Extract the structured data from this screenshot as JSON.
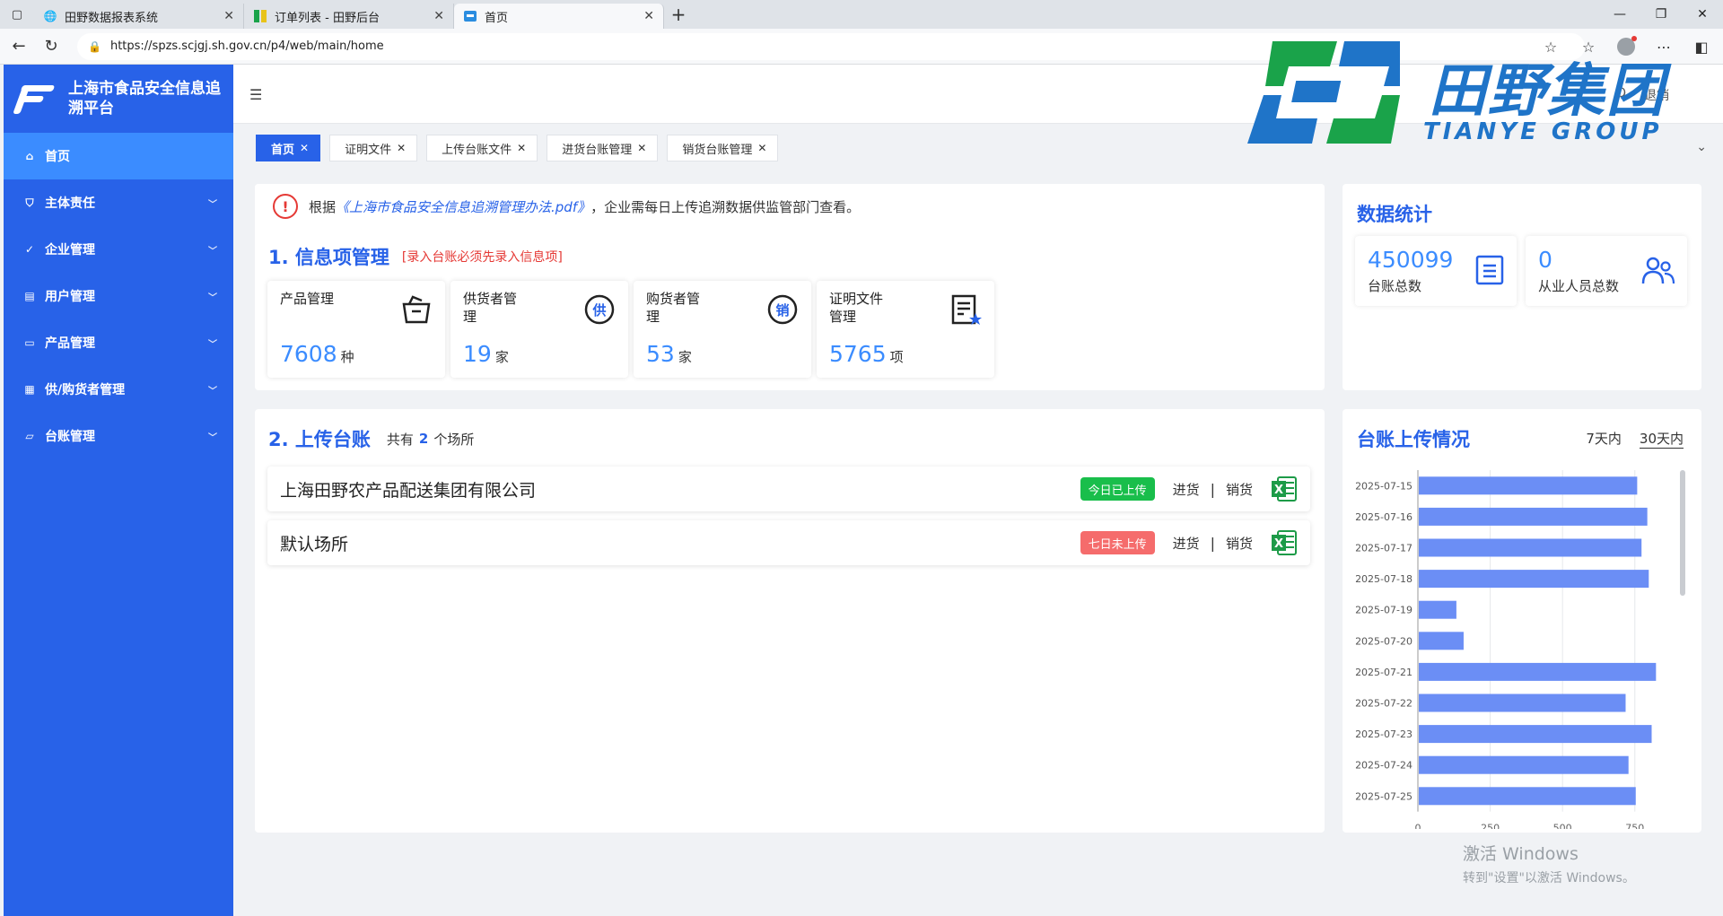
{
  "browser": {
    "tabs": [
      {
        "label": "田野数据报表系统",
        "icon": "globe-icon"
      },
      {
        "label": "订单列表 - 田野后台",
        "icon": "site-favicon"
      },
      {
        "label": "首页",
        "icon": "site-favicon"
      }
    ],
    "url": "https://spzs.scjgj.sh.gov.cn/p4/web/main/home"
  },
  "sidebar": {
    "title": "上海市食品安全信息追溯平台",
    "items": [
      {
        "label": "首页",
        "icon": "home-icon",
        "active": true
      },
      {
        "label": "主体责任",
        "icon": "shield-icon"
      },
      {
        "label": "企业管理",
        "icon": "shield-check-icon"
      },
      {
        "label": "用户管理",
        "icon": "id-card-icon"
      },
      {
        "label": "产品管理",
        "icon": "folder-icon"
      },
      {
        "label": "供/购货者管理",
        "icon": "contacts-icon"
      },
      {
        "label": "台账管理",
        "icon": "folder-open-icon"
      }
    ]
  },
  "header": {
    "user_partial": "Q",
    "user_partial2": "退销"
  },
  "tags": [
    {
      "label": "首页",
      "active": true
    },
    {
      "label": "证明文件"
    },
    {
      "label": "上传台账文件"
    },
    {
      "label": "进货台账管理"
    },
    {
      "label": "销货台账管理"
    }
  ],
  "notice": {
    "prefix": "根据",
    "link": "《上海市食品安全信息追溯管理办法.pdf》",
    "suffix": "，企业需每日上传追溯数据供监管部门查看。"
  },
  "info_section": {
    "title": "1. 信息项管理",
    "note": "[录入台账必须先录入信息项]",
    "tiles": [
      {
        "name": "产品管理",
        "value": "7608",
        "unit": "种",
        "icon": "basket-icon"
      },
      {
        "name": "供货者管理",
        "value": "19",
        "unit": "家",
        "icon": "supplier-icon",
        "glyph": "供"
      },
      {
        "name": "购货者管理",
        "value": "53",
        "unit": "家",
        "icon": "buyer-icon",
        "glyph": "销"
      },
      {
        "name": "证明文件管理",
        "value": "5765",
        "unit": "项",
        "icon": "certificate-icon"
      }
    ]
  },
  "upload_section": {
    "title": "2. 上传台账",
    "count_prefix": "共有",
    "count": "2",
    "count_suffix": "个场所",
    "places": [
      {
        "name": "上海田野农产品配送集团有限公司",
        "status": "今日已上传",
        "status_color": "#19be4b",
        "in": "进货",
        "sep": "|",
        "out": "销货"
      },
      {
        "name": "默认场所",
        "status": "七日未上传",
        "status_color": "#f56c6c",
        "in": "进货",
        "sep": "|",
        "out": "销货"
      }
    ]
  },
  "stats": {
    "title": "数据统计",
    "ledger_total": "450099",
    "ledger_label": "台账总数",
    "staff_total": "0",
    "staff_label": "从业人员总数"
  },
  "chart_card": {
    "title": "台账上传情况",
    "range_7": "7天内",
    "range_30": "30天内"
  },
  "chart_data": {
    "type": "bar",
    "orientation": "horizontal",
    "categories": [
      "2025-07-15",
      "2025-07-16",
      "2025-07-17",
      "2025-07-18",
      "2025-07-19",
      "2025-07-20",
      "2025-07-21",
      "2025-07-22",
      "2025-07-23",
      "2025-07-24",
      "2025-07-25"
    ],
    "values": [
      755,
      790,
      770,
      795,
      130,
      155,
      820,
      715,
      805,
      725,
      750
    ],
    "xlim": [
      0,
      850
    ],
    "xticks": [
      0,
      250,
      500,
      750
    ],
    "color": "#6b8ef5",
    "grid": true
  },
  "watermark": {
    "line1": "激活 Windows",
    "line2": "转到\"设置\"以激活 Windows。"
  },
  "overlay_logo": {
    "cn": "田野集团",
    "en": "TIANYE GROUP"
  }
}
